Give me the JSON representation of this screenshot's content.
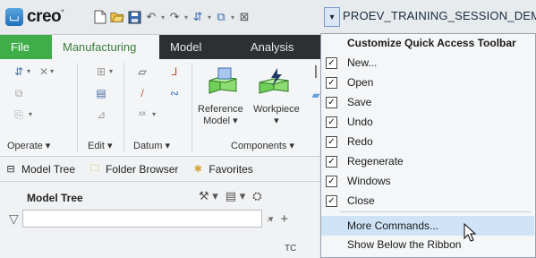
{
  "app": {
    "logo_text": "creo",
    "logo_sup": "°",
    "window_title": "PROEV_TRAINING_SESSION_DEMO ("
  },
  "quick_access": {
    "icons": [
      "new-icon",
      "open-icon",
      "save-icon",
      "undo-icon",
      "redo-icon",
      "regenerate-icon",
      "windows-icon",
      "close-icon"
    ],
    "customize_glyph": "▾"
  },
  "ribbon": {
    "tabs": [
      {
        "label": "File"
      },
      {
        "label": "Manufacturing"
      },
      {
        "label": "Model"
      },
      {
        "label": "Analysis"
      }
    ],
    "groups": {
      "operate": "Operate",
      "edit": "Edit",
      "datum": "Datum",
      "components": "Components"
    },
    "buttons": {
      "reference_model": "Reference",
      "reference_model_2": "Model",
      "workpiece": "Workpiece"
    }
  },
  "panel": {
    "tabs": [
      {
        "label": "Model Tree",
        "icon": "model-tree-icon"
      },
      {
        "label": "Folder Browser",
        "icon": "folder-icon"
      },
      {
        "label": "Favorites",
        "icon": "star-folder-icon"
      }
    ],
    "tree_title": "Model Tree",
    "filter_placeholder": "",
    "filter_value": "",
    "column_header": "TC"
  },
  "menu": {
    "title": "Customize Quick Access Toolbar",
    "items": [
      {
        "label": "New...",
        "checked": true
      },
      {
        "label": "Open",
        "checked": true
      },
      {
        "label": "Save",
        "checked": true
      },
      {
        "label": "Undo",
        "checked": true
      },
      {
        "label": "Redo",
        "checked": true
      },
      {
        "label": "Regenerate",
        "checked": true
      },
      {
        "label": "Windows",
        "checked": true
      },
      {
        "label": "Close",
        "checked": true
      }
    ],
    "more_commands": "More Commands...",
    "show_below": "Show Below the Ribbon"
  },
  "colors": {
    "file_tab": "#3fae49",
    "tab_bar": "#2d3033",
    "active_tab_text": "#3a7d3a",
    "menu_highlight": "#cfe3f7"
  }
}
